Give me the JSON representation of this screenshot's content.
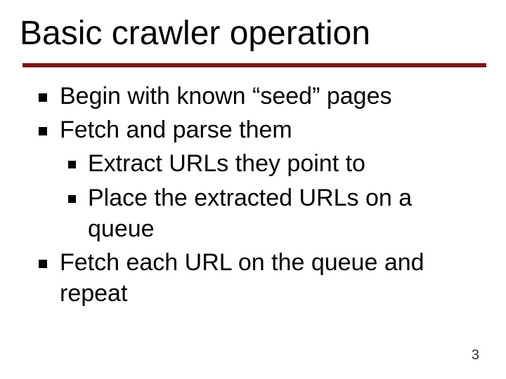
{
  "title": "Basic crawler operation",
  "bullets": {
    "b1": "Begin with known “seed” pages",
    "b2": "Fetch and parse them",
    "b2a": "Extract URLs they point to",
    "b2b": "Place the extracted URLs on a queue",
    "b3": "Fetch each URL on the queue and repeat"
  },
  "page_number": "3"
}
